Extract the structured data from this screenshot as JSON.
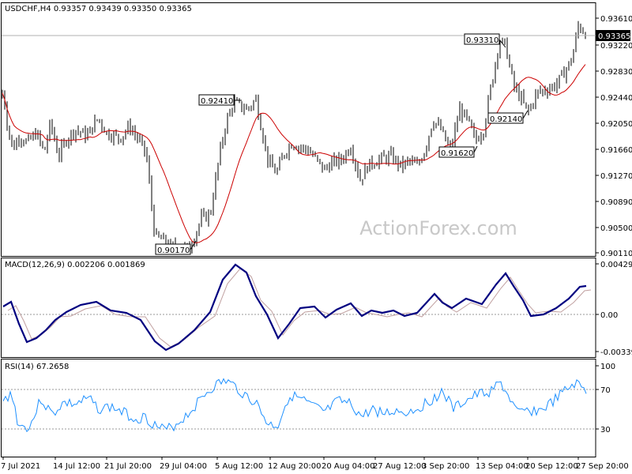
{
  "chart_data": [
    {
      "type": "candlestick",
      "panel": "price",
      "header": "USDCHF,H4  0.93357 0.93439 0.93350 0.93365",
      "ylim": [
        0.9011,
        0.9361
      ],
      "y_ticks": [
        "0.93610",
        "0.93220",
        "0.92830",
        "0.92440",
        "0.92050",
        "0.91660",
        "0.91270",
        "0.90890",
        "0.90500",
        "0.90110"
      ],
      "current_price": "0.93365",
      "moving_average_color": "#cc0000",
      "candle_color": "#000000",
      "annotations": [
        {
          "label": "0.92410",
          "value": 0.9241
        },
        {
          "label": "0.90170",
          "value": 0.9017
        },
        {
          "label": "0.93310",
          "value": 0.9331
        },
        {
          "label": "0.92140",
          "value": 0.9214
        },
        {
          "label": "0.91620",
          "value": 0.9162
        }
      ],
      "watermark": "ActionForex.com"
    },
    {
      "type": "line",
      "panel": "macd",
      "header": "MACD(12,26,9) 0.002206 0.001869",
      "ylim": [
        -0.003396,
        0.004299
      ],
      "y_ticks": [
        "0.004299",
        "0.00",
        "-0.003396"
      ],
      "series": [
        {
          "name": "MACD",
          "color": "#000080"
        },
        {
          "name": "Signal",
          "color": "#c0a0a0"
        }
      ]
    },
    {
      "type": "line",
      "panel": "rsi",
      "header": "RSI(14) 67.2658",
      "ylim": [
        0,
        100
      ],
      "y_ticks": [
        "100",
        "70",
        "30",
        "0"
      ],
      "levels": [
        70,
        30
      ],
      "series": [
        {
          "name": "RSI",
          "color": "#1e90ff"
        }
      ]
    }
  ],
  "x_ticks": [
    "7 Jul 2021",
    "14 Jul 12:00",
    "21 Jul 20:00",
    "29 Jul 04:00",
    "5 Aug 12:00",
    "12 Aug 20:00",
    "20 Aug 04:00",
    "27 Aug 12:00",
    "3 Sep 20:00",
    "13 Sep 04:00",
    "20 Sep 12:00",
    "27 Sep 20:00"
  ]
}
